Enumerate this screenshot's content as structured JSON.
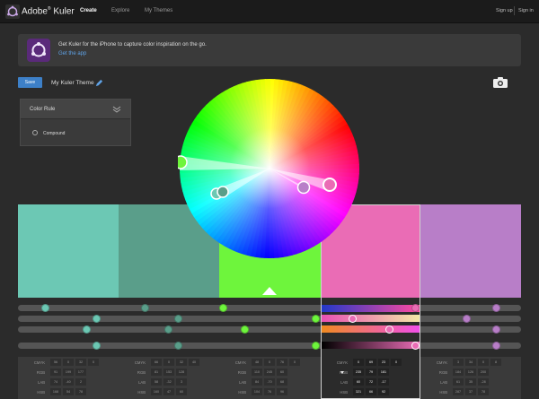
{
  "app": {
    "brand": "Adobe",
    "brand_mark": "®",
    "brand_product": "Kuler"
  },
  "nav": {
    "create": "Create",
    "explore": "Explore",
    "my_themes": "My Themes"
  },
  "auth": {
    "sign_up": "Sign up",
    "sign_in": "Sign in"
  },
  "banner": {
    "text": "Get Kuler for the iPhone to capture color inspiration on the go.",
    "link": "Get the app"
  },
  "toolbar": {
    "save_label": "Save",
    "theme_name": "My Kuler Theme"
  },
  "color_rule": {
    "title": "Color Rule",
    "selected": "Compound"
  },
  "colors": {
    "swatch_1": "#6cc8b4",
    "swatch_2": "#5a9e8a",
    "swatch_3": "#6ef53c",
    "swatch_4": "#ea6cb5",
    "swatch_5": "#b87ec8",
    "accent_blue": "#3d80c8"
  },
  "sliders": {
    "row_1": "RGB red",
    "row_2": "RGB green",
    "row_3": "RGB blue",
    "row_4": "Brightness"
  },
  "values": {
    "labels": {
      "cmyk": "CMYK",
      "rgb": "RGB",
      "lab": "LAB",
      "hsb": "HSB"
    },
    "col_1": {
      "cmyk": [
        "56",
        "0",
        "32",
        "0"
      ],
      "rgb": [
        "91",
        "199",
        "177"
      ],
      "lab": [
        "74",
        "-40",
        "2"
      ],
      "hsb": [
        "168",
        "54",
        "78"
      ]
    },
    "col_2": {
      "cmyk": [
        "66",
        "0",
        "32",
        "40"
      ],
      "rgb": [
        "81",
        "153",
        "128"
      ],
      "lab": [
        "58",
        "-32",
        "3"
      ],
      "hsb": [
        "160",
        "47",
        "60"
      ]
    },
    "col_3": {
      "cmyk": [
        "48",
        "0",
        "76",
        "0"
      ],
      "rgb": [
        "110",
        "245",
        "60"
      ],
      "lab": [
        "84",
        "-70",
        "68"
      ],
      "hsb": [
        "104",
        "76",
        "96"
      ]
    },
    "col_4": {
      "cmyk": [
        "0",
        "69",
        "23",
        "0"
      ],
      "rgb": [
        "235",
        "79",
        "181"
      ],
      "lab": [
        "60",
        "72",
        "-17"
      ],
      "hsb": [
        "321",
        "66",
        "92"
      ]
    },
    "col_5": {
      "cmyk": [
        "3",
        "34",
        "0",
        "8"
      ],
      "rgb": [
        "184",
        "126",
        "200"
      ],
      "lab": [
        "61",
        "35",
        "-28"
      ],
      "hsb": [
        "287",
        "37",
        "78"
      ]
    }
  }
}
